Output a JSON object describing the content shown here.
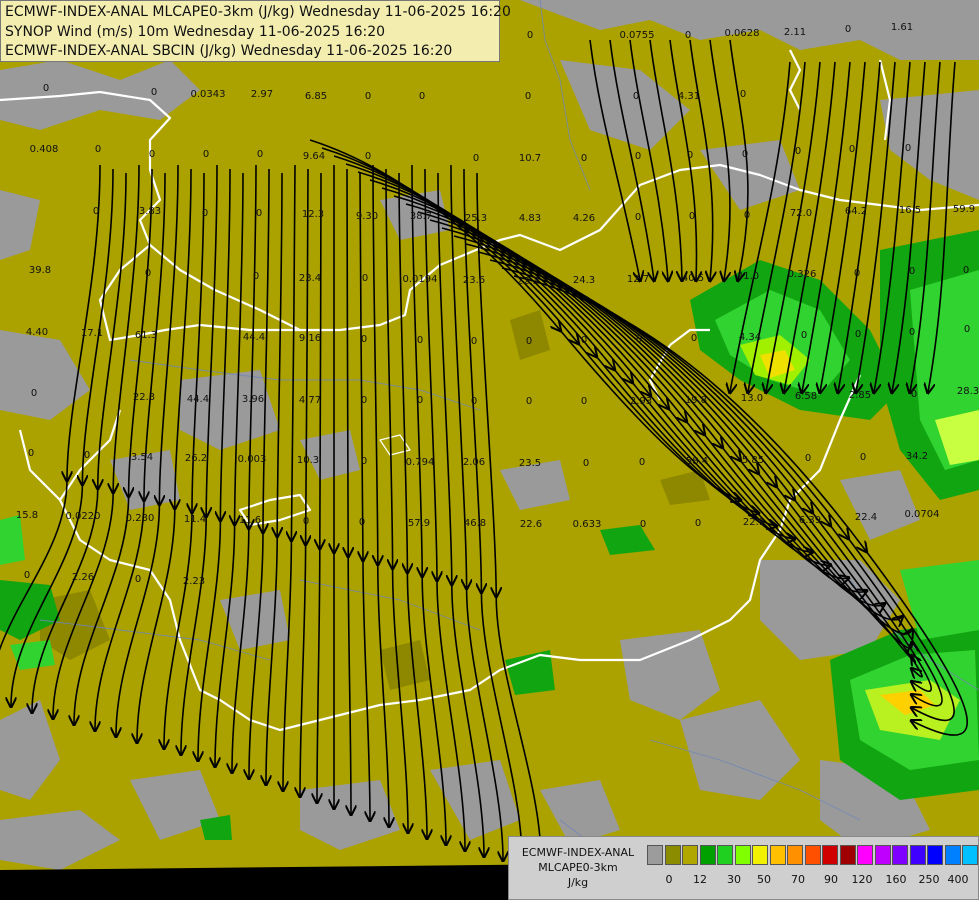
{
  "header": {
    "line1": "ECMWF-INDEX-ANAL MLCAPE0-3km (J/kg) Wednesday 11-06-2025 16:20",
    "line2": "SYNOP Wind (m/s) 10m Wednesday 11-06-2025 16:20",
    "line3": "ECMWF-INDEX-ANAL SBCIN (J/kg) Wednesday 11-06-2025 16:20"
  },
  "legend": {
    "line1": "ECMWF-INDEX-ANAL",
    "line2": "MLCAPE0-3km",
    "unit": "J/kg",
    "colors": [
      "#9c9c9c",
      "#8c8c00",
      "#b0a800",
      "#00a000",
      "#20d020",
      "#80ff00",
      "#f0f000",
      "#ffc000",
      "#ff9000",
      "#ff5000",
      "#d00000",
      "#a00000",
      "#ff00ff",
      "#c000ff",
      "#8000ff",
      "#4000ff",
      "#0000ff",
      "#0080ff",
      "#00c0ff",
      "#00ffff",
      "#ffffff"
    ],
    "ticks": [
      "0",
      "12",
      "30",
      "50",
      "70",
      "90",
      "120",
      "160",
      "250",
      "400"
    ]
  },
  "values": [
    "0",
    "0.0755",
    "0",
    "0.0628",
    "2.11",
    "0",
    "1.61",
    "0",
    "0",
    "0.0343",
    "2.97",
    "6.85",
    "0",
    "0",
    "0",
    "0",
    "4.31",
    "0",
    "0.408",
    "0",
    "0",
    "0",
    "0",
    "9.64",
    "0",
    "0",
    "10.7",
    "0",
    "0",
    "0",
    "0",
    "0",
    "0",
    "0",
    "0",
    "3.83",
    "0",
    "0",
    "12.3",
    "9.30",
    "38.7",
    "25.3",
    "4.83",
    "4.26",
    "0",
    "0",
    "0",
    "72.0",
    "64.2",
    "16.5",
    "59.9",
    "39.8",
    "0",
    "0",
    "23.4",
    "0",
    "0.0194",
    "23.6",
    "22.3",
    "24.3",
    "12.7",
    "40.5",
    "41.0",
    "0.326",
    "0",
    "0",
    "0",
    "4.40",
    "17.1",
    "61.3",
    "44.4",
    "9.16",
    "0",
    "0",
    "0",
    "0",
    "0",
    "0",
    "0",
    "4.34",
    "0",
    "0",
    "0",
    "0",
    "0",
    "22.3",
    "44.4",
    "3.96",
    "4.77",
    "0",
    "0",
    "0",
    "0",
    "0",
    "2.93",
    "19.8",
    "13.0",
    "6.58",
    "2.85",
    "0",
    "28.3",
    "0",
    "0",
    "3.54",
    "26.2",
    "0.003",
    "10.3",
    "0",
    "0.794",
    "2.06",
    "23.5",
    "0",
    "0",
    "58.4",
    "5.85",
    "0",
    "0",
    "34.2",
    "15.8",
    "0.0220",
    "0.230",
    "11.4",
    "11.6",
    "0",
    "0",
    "57.9",
    "46.8",
    "22.6",
    "0.633",
    "0",
    "0",
    "22.1",
    "6.39",
    "22.4",
    "0.0704",
    "0",
    "2.26",
    "0",
    "2.23"
  ]
}
